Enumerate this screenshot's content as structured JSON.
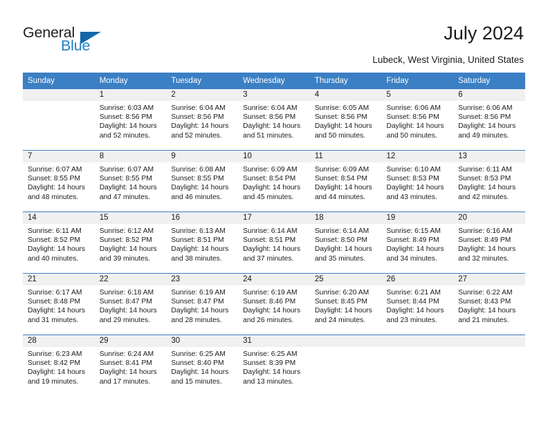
{
  "brand": {
    "name_top": "General",
    "name_bottom": "Blue",
    "triangle_color": "#1566ab",
    "accent_color": "#3b7fc4"
  },
  "header": {
    "title": "July 2024",
    "location": "Lubeck, West Virginia, United States"
  },
  "calendar": {
    "weekday_headers": [
      "Sunday",
      "Monday",
      "Tuesday",
      "Wednesday",
      "Thursday",
      "Friday",
      "Saturday"
    ],
    "weeks": [
      [
        {
          "day": "",
          "sunrise": "",
          "sunset": "",
          "daylight_1": "",
          "daylight_2": ""
        },
        {
          "day": "1",
          "sunrise": "Sunrise: 6:03 AM",
          "sunset": "Sunset: 8:56 PM",
          "daylight_1": "Daylight: 14 hours",
          "daylight_2": "and 52 minutes."
        },
        {
          "day": "2",
          "sunrise": "Sunrise: 6:04 AM",
          "sunset": "Sunset: 8:56 PM",
          "daylight_1": "Daylight: 14 hours",
          "daylight_2": "and 52 minutes."
        },
        {
          "day": "3",
          "sunrise": "Sunrise: 6:04 AM",
          "sunset": "Sunset: 8:56 PM",
          "daylight_1": "Daylight: 14 hours",
          "daylight_2": "and 51 minutes."
        },
        {
          "day": "4",
          "sunrise": "Sunrise: 6:05 AM",
          "sunset": "Sunset: 8:56 PM",
          "daylight_1": "Daylight: 14 hours",
          "daylight_2": "and 50 minutes."
        },
        {
          "day": "5",
          "sunrise": "Sunrise: 6:06 AM",
          "sunset": "Sunset: 8:56 PM",
          "daylight_1": "Daylight: 14 hours",
          "daylight_2": "and 50 minutes."
        },
        {
          "day": "6",
          "sunrise": "Sunrise: 6:06 AM",
          "sunset": "Sunset: 8:56 PM",
          "daylight_1": "Daylight: 14 hours",
          "daylight_2": "and 49 minutes."
        }
      ],
      [
        {
          "day": "7",
          "sunrise": "Sunrise: 6:07 AM",
          "sunset": "Sunset: 8:55 PM",
          "daylight_1": "Daylight: 14 hours",
          "daylight_2": "and 48 minutes."
        },
        {
          "day": "8",
          "sunrise": "Sunrise: 6:07 AM",
          "sunset": "Sunset: 8:55 PM",
          "daylight_1": "Daylight: 14 hours",
          "daylight_2": "and 47 minutes."
        },
        {
          "day": "9",
          "sunrise": "Sunrise: 6:08 AM",
          "sunset": "Sunset: 8:55 PM",
          "daylight_1": "Daylight: 14 hours",
          "daylight_2": "and 46 minutes."
        },
        {
          "day": "10",
          "sunrise": "Sunrise: 6:09 AM",
          "sunset": "Sunset: 8:54 PM",
          "daylight_1": "Daylight: 14 hours",
          "daylight_2": "and 45 minutes."
        },
        {
          "day": "11",
          "sunrise": "Sunrise: 6:09 AM",
          "sunset": "Sunset: 8:54 PM",
          "daylight_1": "Daylight: 14 hours",
          "daylight_2": "and 44 minutes."
        },
        {
          "day": "12",
          "sunrise": "Sunrise: 6:10 AM",
          "sunset": "Sunset: 8:53 PM",
          "daylight_1": "Daylight: 14 hours",
          "daylight_2": "and 43 minutes."
        },
        {
          "day": "13",
          "sunrise": "Sunrise: 6:11 AM",
          "sunset": "Sunset: 8:53 PM",
          "daylight_1": "Daylight: 14 hours",
          "daylight_2": "and 42 minutes."
        }
      ],
      [
        {
          "day": "14",
          "sunrise": "Sunrise: 6:11 AM",
          "sunset": "Sunset: 8:52 PM",
          "daylight_1": "Daylight: 14 hours",
          "daylight_2": "and 40 minutes."
        },
        {
          "day": "15",
          "sunrise": "Sunrise: 6:12 AM",
          "sunset": "Sunset: 8:52 PM",
          "daylight_1": "Daylight: 14 hours",
          "daylight_2": "and 39 minutes."
        },
        {
          "day": "16",
          "sunrise": "Sunrise: 6:13 AM",
          "sunset": "Sunset: 8:51 PM",
          "daylight_1": "Daylight: 14 hours",
          "daylight_2": "and 38 minutes."
        },
        {
          "day": "17",
          "sunrise": "Sunrise: 6:14 AM",
          "sunset": "Sunset: 8:51 PM",
          "daylight_1": "Daylight: 14 hours",
          "daylight_2": "and 37 minutes."
        },
        {
          "day": "18",
          "sunrise": "Sunrise: 6:14 AM",
          "sunset": "Sunset: 8:50 PM",
          "daylight_1": "Daylight: 14 hours",
          "daylight_2": "and 35 minutes."
        },
        {
          "day": "19",
          "sunrise": "Sunrise: 6:15 AM",
          "sunset": "Sunset: 8:49 PM",
          "daylight_1": "Daylight: 14 hours",
          "daylight_2": "and 34 minutes."
        },
        {
          "day": "20",
          "sunrise": "Sunrise: 6:16 AM",
          "sunset": "Sunset: 8:49 PM",
          "daylight_1": "Daylight: 14 hours",
          "daylight_2": "and 32 minutes."
        }
      ],
      [
        {
          "day": "21",
          "sunrise": "Sunrise: 6:17 AM",
          "sunset": "Sunset: 8:48 PM",
          "daylight_1": "Daylight: 14 hours",
          "daylight_2": "and 31 minutes."
        },
        {
          "day": "22",
          "sunrise": "Sunrise: 6:18 AM",
          "sunset": "Sunset: 8:47 PM",
          "daylight_1": "Daylight: 14 hours",
          "daylight_2": "and 29 minutes."
        },
        {
          "day": "23",
          "sunrise": "Sunrise: 6:19 AM",
          "sunset": "Sunset: 8:47 PM",
          "daylight_1": "Daylight: 14 hours",
          "daylight_2": "and 28 minutes."
        },
        {
          "day": "24",
          "sunrise": "Sunrise: 6:19 AM",
          "sunset": "Sunset: 8:46 PM",
          "daylight_1": "Daylight: 14 hours",
          "daylight_2": "and 26 minutes."
        },
        {
          "day": "25",
          "sunrise": "Sunrise: 6:20 AM",
          "sunset": "Sunset: 8:45 PM",
          "daylight_1": "Daylight: 14 hours",
          "daylight_2": "and 24 minutes."
        },
        {
          "day": "26",
          "sunrise": "Sunrise: 6:21 AM",
          "sunset": "Sunset: 8:44 PM",
          "daylight_1": "Daylight: 14 hours",
          "daylight_2": "and 23 minutes."
        },
        {
          "day": "27",
          "sunrise": "Sunrise: 6:22 AM",
          "sunset": "Sunset: 8:43 PM",
          "daylight_1": "Daylight: 14 hours",
          "daylight_2": "and 21 minutes."
        }
      ],
      [
        {
          "day": "28",
          "sunrise": "Sunrise: 6:23 AM",
          "sunset": "Sunset: 8:42 PM",
          "daylight_1": "Daylight: 14 hours",
          "daylight_2": "and 19 minutes."
        },
        {
          "day": "29",
          "sunrise": "Sunrise: 6:24 AM",
          "sunset": "Sunset: 8:41 PM",
          "daylight_1": "Daylight: 14 hours",
          "daylight_2": "and 17 minutes."
        },
        {
          "day": "30",
          "sunrise": "Sunrise: 6:25 AM",
          "sunset": "Sunset: 8:40 PM",
          "daylight_1": "Daylight: 14 hours",
          "daylight_2": "and 15 minutes."
        },
        {
          "day": "31",
          "sunrise": "Sunrise: 6:25 AM",
          "sunset": "Sunset: 8:39 PM",
          "daylight_1": "Daylight: 14 hours",
          "daylight_2": "and 13 minutes."
        },
        {
          "day": "",
          "sunrise": "",
          "sunset": "",
          "daylight_1": "",
          "daylight_2": ""
        },
        {
          "day": "",
          "sunrise": "",
          "sunset": "",
          "daylight_1": "",
          "daylight_2": ""
        },
        {
          "day": "",
          "sunrise": "",
          "sunset": "",
          "daylight_1": "",
          "daylight_2": ""
        }
      ]
    ]
  }
}
